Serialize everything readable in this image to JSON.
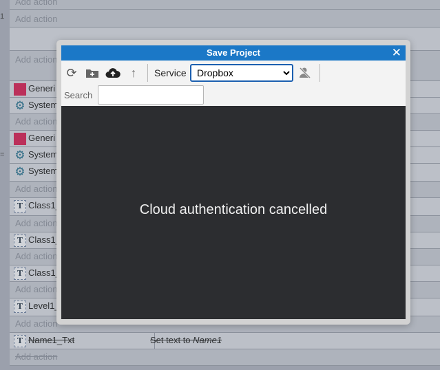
{
  "background": {
    "rows": [
      {
        "kind": "action",
        "text": "Add action"
      },
      {
        "kind": "action",
        "text": "Add action"
      },
      {
        "kind": "cond",
        "text": ""
      },
      {
        "kind": "action",
        "text": "Add action"
      },
      {
        "kind": "cond",
        "icon": "red-square-icon",
        "text": "Generi"
      },
      {
        "kind": "cond",
        "icon": "gear-icon",
        "text": "System"
      },
      {
        "kind": "action",
        "text": "Add action"
      },
      {
        "kind": "cond",
        "icon": "red-square-icon",
        "text": "Generi"
      },
      {
        "kind": "cond",
        "icon": "gear-icon",
        "text": "System"
      },
      {
        "kind": "cond",
        "icon": "gear-icon",
        "text": "System"
      },
      {
        "kind": "action",
        "text": "Add action"
      },
      {
        "kind": "cond",
        "icon": "text-object-icon",
        "text": "Class1_"
      },
      {
        "kind": "action",
        "text": "Add action"
      },
      {
        "kind": "cond",
        "icon": "text-object-icon",
        "text": "Class1_"
      },
      {
        "kind": "action",
        "text": "Add action"
      },
      {
        "kind": "cond",
        "icon": "text-object-icon",
        "text": "Class1_"
      },
      {
        "kind": "action",
        "text": "Add action"
      },
      {
        "kind": "cond",
        "icon": "text-object-icon",
        "text": "Level1_"
      },
      {
        "kind": "action",
        "text": "Add action"
      },
      {
        "kind": "cond",
        "icon": "text-object-icon",
        "text": "Name1_Txt",
        "action_text": "Set text to ",
        "action_em": "Name1",
        "strike": true
      },
      {
        "kind": "action",
        "text": "Add action",
        "strike": true
      }
    ],
    "marks": [
      "1",
      "="
    ]
  },
  "dialog": {
    "title": "Save Project",
    "close_glyph": "✕",
    "toolbar": {
      "refresh_glyph": "⟳",
      "new_folder_glyph": "＋",
      "upload_glyph": "☁",
      "up_glyph": "↑",
      "service_label": "Service",
      "service_value": "Dropbox",
      "service_options": [
        "Dropbox"
      ],
      "signout_glyph": "⊘"
    },
    "search": {
      "label": "Search",
      "value": ""
    },
    "message": "Cloud authentication cancelled"
  },
  "colors": {
    "title_bar": "#1b78c7",
    "content_bg": "#2c2d30",
    "accent_red": "#d6134a"
  }
}
